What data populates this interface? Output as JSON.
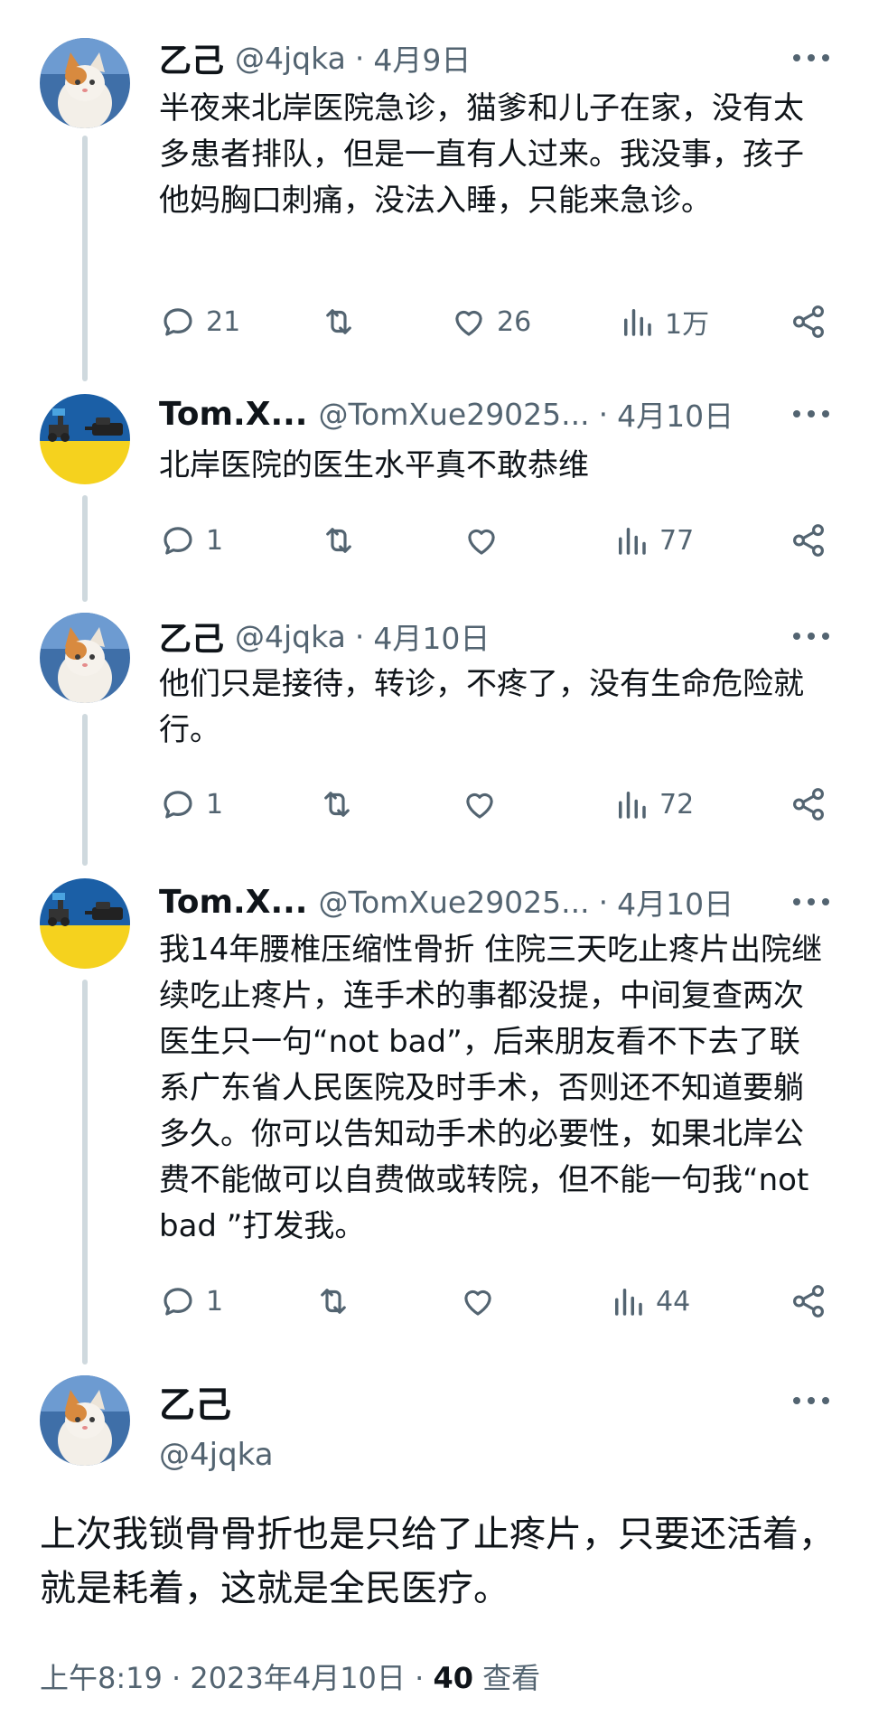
{
  "thread": [
    {
      "name": "乙己",
      "handle": "@4jqka",
      "date": "4月9日",
      "text": "半夜来北岸医院急诊，猫爹和儿子在家，没有太多患者排队，但是一直有人过来。我没事，孩子他妈胸口刺痛，没法入睡，只能来急诊。",
      "replies": "21",
      "retweets": "",
      "likes": "26",
      "views": "1万",
      "avatar": "cat-avatar"
    },
    {
      "name": "Tom.X...",
      "handle": "@TomXue29025...",
      "date": "4月10日",
      "text": "北岸医院的医生水平真不敢恭维",
      "replies": "1",
      "retweets": "",
      "likes": "",
      "views": "77",
      "avatar": "tank-avatar"
    },
    {
      "name": "乙己",
      "handle": "@4jqka",
      "date": "4月10日",
      "text": "他们只是接待，转诊，不疼了，没有生命危险就行。",
      "replies": "1",
      "retweets": "",
      "likes": "",
      "views": "72",
      "avatar": "cat-avatar"
    },
    {
      "name": "Tom.X...",
      "handle": "@TomXue29025...",
      "date": "4月10日",
      "text": "我14年腰椎压缩性骨折 住院三天吃止疼片出院继续吃止疼片，连手术的事都没提，中间复查两次医生只一句“not bad”，后来朋友看不下去了联系广东省人民医院及时手术，否则还不知道要躺多久。你可以告知动手术的必要性，如果北岸公费不能做可以自费做或转院，但不能一句我“not bad ”打发我。",
      "replies": "1",
      "retweets": "",
      "likes": "",
      "views": "44",
      "avatar": "tank-avatar"
    }
  ],
  "main": {
    "name": "乙己",
    "handle": "@4jqka",
    "text": "上次我锁骨骨折也是只给了止疼片，只要还活着，就是耗着，这就是全民医疗。",
    "time": "上午8:19",
    "date": "2023年4月10日",
    "views_count": "40",
    "views_label": "查看"
  },
  "separator": "·",
  "icons": {
    "reply": "reply-icon",
    "retweet": "retweet-icon",
    "like": "like-icon",
    "views": "views-icon",
    "share": "share-icon",
    "more": "more-icon"
  },
  "colors": {
    "text": "#0f1419",
    "secondary": "#536471",
    "thread_line": "#cfd9de"
  }
}
